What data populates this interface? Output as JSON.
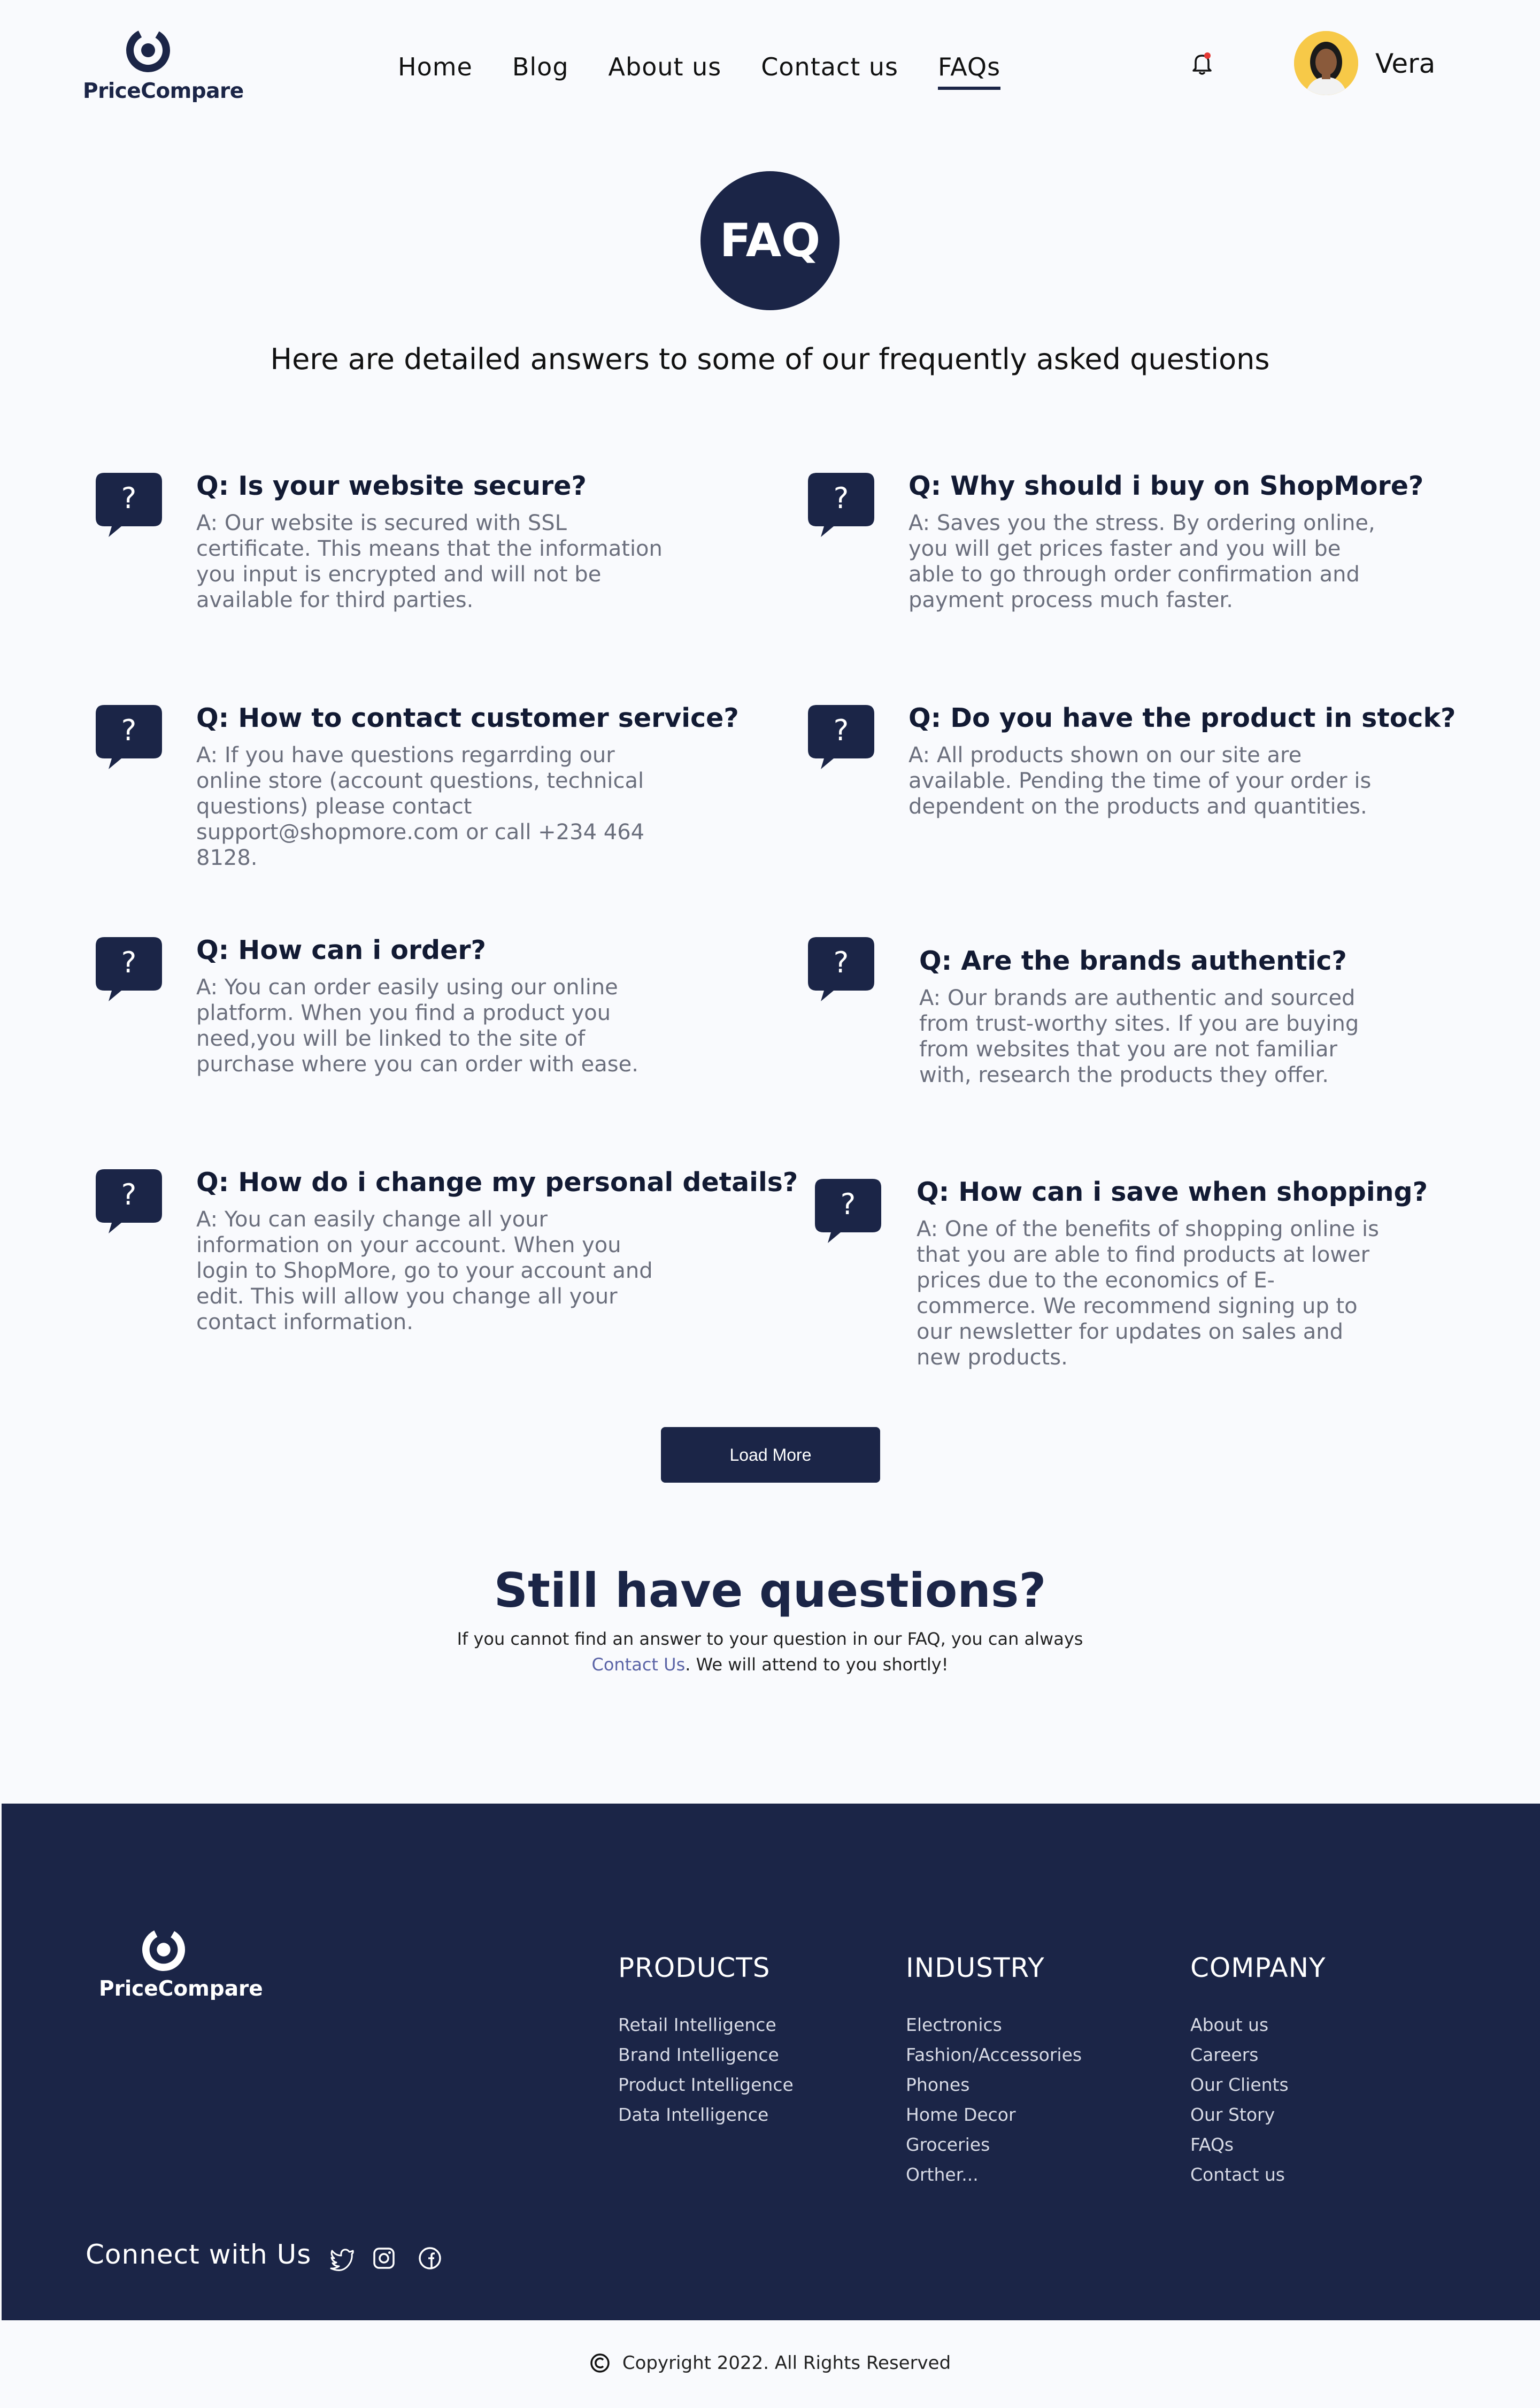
{
  "brand": {
    "name": "PriceCompare",
    "color": "#1b2547"
  },
  "nav": {
    "items": [
      "Home",
      "Blog",
      "About us",
      "Contact us",
      "FAQs"
    ],
    "active": "FAQs",
    "notification_icon": "bell-icon",
    "notification_color": "#e53935",
    "user": {
      "name": "Vera"
    }
  },
  "hero": {
    "badge": "FAQ",
    "subtitle": "Here are detailed answers to some of our frequently asked questions"
  },
  "faqs": [
    {
      "q": "Q: Is your website secure?",
      "a": "A: Our website is secured with SSL certificate. This means that the information you input is encrypted and will not be available for third parties."
    },
    {
      "q": "Q: Why should i buy on ShopMore?",
      "a": "A: Saves you the stress. By ordering online, you will get prices faster and you will be able to go through order confirmation and payment process much faster."
    },
    {
      "q": "Q: How to contact customer service?",
      "a": "A: If you have questions regarrding our online store (account questions, technical questions) please contact support@shopmore.com or call +234 464 8128."
    },
    {
      "q": "Q: Do you have the product in stock?",
      "a": "A: All products shown on our site are available. Pending the time of your order is dependent on the products and quantities."
    },
    {
      "q": "Q: How can i order?",
      "a": "A: You can order easily using our online platform. When you find a product you need,you will be linked to the site of purchase where you can order with ease."
    },
    {
      "q": "Q: Are the brands authentic?",
      "a": "A: Our brands are authentic and sourced from trust-worthy sites. If you are buying from websites that you are not familiar with, research the products they offer."
    },
    {
      "q": "Q: How do i change my personal details?",
      "a": "A: You can easily change all your information on your account. When you login to ShopMore, go to your account and edit. This will allow you change all your contact information."
    },
    {
      "q": "Q: How can i save when shopping?",
      "a": "A: One of the benefits of shopping online is that you are able to find products at lower prices due to the economics of  E-commerce.  We recommend signing up to our newsletter for updates on sales and new products."
    }
  ],
  "load_more": "Load More",
  "still": {
    "title": "Still have questions?",
    "text": "If you cannot find an answer to your question in our FAQ, you can always ",
    "link": "Contact Us",
    "text_after": ". We will attend to you shortly!"
  },
  "footer": {
    "columns": [
      {
        "title": "PRODUCTS",
        "items": [
          "Retail Intelligence",
          "Brand Intelligence",
          "Product Intelligence",
          "Data Intelligence"
        ]
      },
      {
        "title": "INDUSTRY",
        "items": [
          "Electronics",
          "Fashion/Accessories",
          "Phones",
          "Home Decor",
          "Groceries",
          "Orther..."
        ]
      },
      {
        "title": "COMPANY",
        "items": [
          "About us",
          "Careers",
          "Our Clients",
          "Our Story",
          "FAQs",
          "Contact us"
        ]
      }
    ],
    "connect": "Connect with Us",
    "social_icons": [
      "twitter-icon",
      "instagram-icon",
      "facebook-icon"
    ]
  },
  "copyright": "Copyright 2022. All Rights Reserved"
}
